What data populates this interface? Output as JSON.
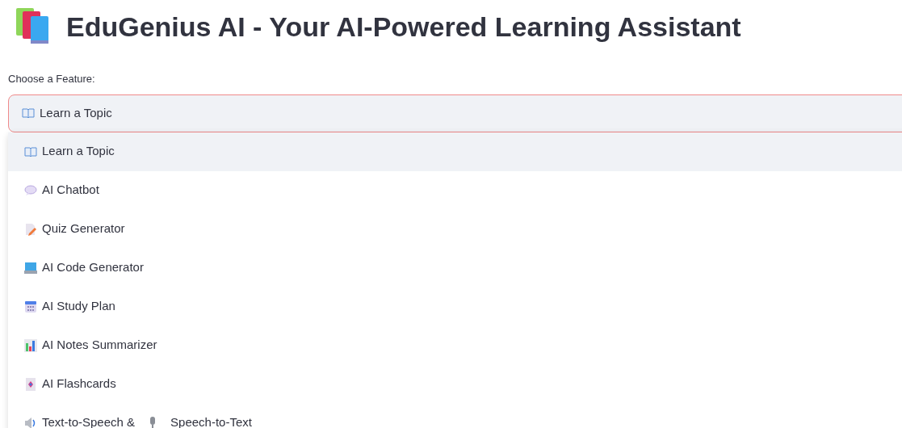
{
  "title": "EduGenius AI - Your AI-Powered Learning Assistant",
  "select": {
    "label": "Choose a Feature:",
    "value": "Learn a Topic",
    "kind": "book",
    "open": true
  },
  "options": [
    {
      "label": "Learn a Topic",
      "kind": "book",
      "selected": true
    },
    {
      "label": "AI Chatbot",
      "kind": "chat",
      "selected": false
    },
    {
      "label": "Quiz Generator",
      "kind": "quiz",
      "selected": false
    },
    {
      "label": "AI Code Generator",
      "kind": "code",
      "selected": false
    },
    {
      "label": "AI Study Plan",
      "kind": "calendar",
      "selected": false
    },
    {
      "label": "AI Notes Summarizer",
      "kind": "chart",
      "selected": false
    },
    {
      "label": "AI Flashcards",
      "kind": "cards",
      "selected": false
    },
    {
      "label": "Text-to-Speech &",
      "label_2": "Speech-to-Text",
      "kind": "speech",
      "selected": false
    }
  ]
}
